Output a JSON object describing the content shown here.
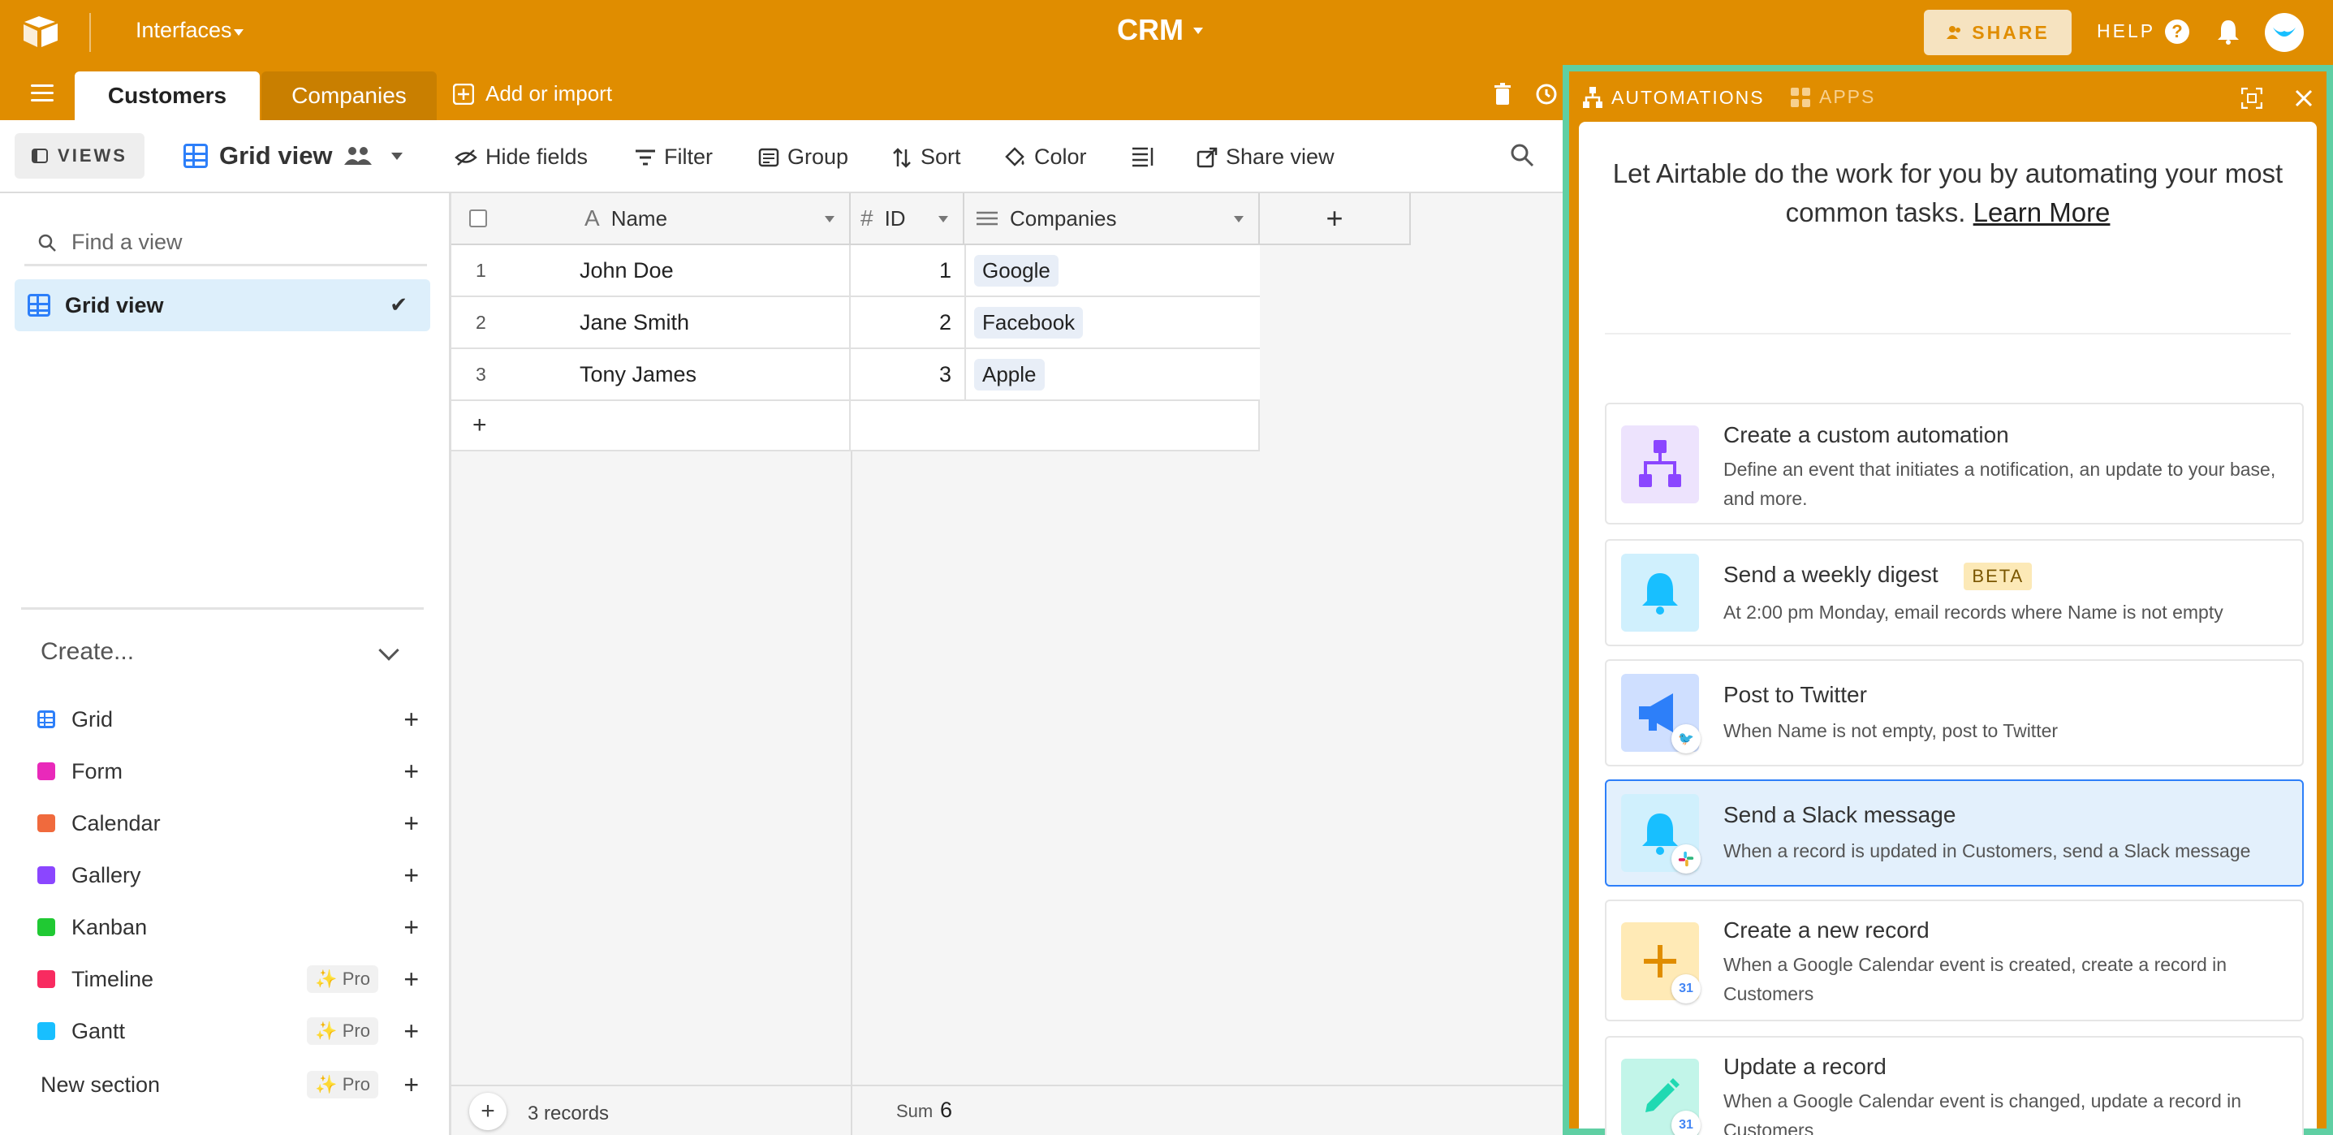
{
  "topbar": {
    "interfaces_label": "Interfaces",
    "base_name": "CRM",
    "share_label": "SHARE",
    "help_label": "HELP",
    "help_icon_glyph": "?"
  },
  "tabs": {
    "active": "Customers",
    "inactive": "Companies",
    "add_import": "Add or import"
  },
  "toolbar": {
    "views_label": "VIEWS",
    "view_name": "Grid view",
    "hide_fields": "Hide fields",
    "filter": "Filter",
    "group": "Group",
    "sort": "Sort",
    "color": "Color",
    "share_view": "Share view"
  },
  "sidebar": {
    "find_placeholder": "Find a view",
    "selected_view": "Grid view",
    "create_header": "Create...",
    "create_items": [
      {
        "label": "Grid",
        "color": "#2d7ff9"
      },
      {
        "label": "Form",
        "color": "#e929ba"
      },
      {
        "label": "Calendar",
        "color": "#f06a3d"
      },
      {
        "label": "Gallery",
        "color": "#8b46ff"
      },
      {
        "label": "Kanban",
        "color": "#20c933"
      },
      {
        "label": "Timeline",
        "color": "#f82b60",
        "pro": "Pro"
      },
      {
        "label": "Gantt",
        "color": "#18bfff",
        "pro": "Pro"
      }
    ],
    "new_section": "New section",
    "new_section_pro": "Pro"
  },
  "grid": {
    "columns": [
      {
        "name": "Name",
        "icon": "text-icon"
      },
      {
        "name": "ID",
        "icon": "number-icon"
      },
      {
        "name": "Companies",
        "icon": "link-icon"
      }
    ],
    "rows": [
      {
        "num": "1",
        "name": "John Doe",
        "id": "1",
        "company": "Google"
      },
      {
        "num": "2",
        "name": "Jane Smith",
        "id": "2",
        "company": "Facebook"
      },
      {
        "num": "3",
        "name": "Tony James",
        "id": "3",
        "company": "Apple"
      }
    ],
    "record_count": "3 records",
    "sum_label": "Sum",
    "sum_value": "6"
  },
  "panel": {
    "automations_tab": "AUTOMATIONS",
    "apps_tab": "APPS",
    "intro_text": "Let Airtable do the work for you by automating your most common tasks.",
    "learn_more": "Learn More",
    "cards": [
      {
        "title": "Create a custom automation",
        "desc": "Define an event that initiates a notification, an update to your base, and more.",
        "icon": "flow-icon"
      },
      {
        "title": "Send a weekly digest",
        "badge": "BETA",
        "desc": "At 2:00 pm Monday, email records where Name is not empty",
        "icon": "bell-icon"
      },
      {
        "title": "Post to Twitter",
        "desc": "When Name is not empty, post to Twitter",
        "icon": "megaphone-icon"
      },
      {
        "title": "Send a Slack message",
        "desc": "When a record is updated in Customers, send a Slack message",
        "icon": "bell-icon"
      },
      {
        "title": "Create a new record",
        "desc": "When a Google Calendar event is created, create a record in Customers",
        "icon": "plus-icon"
      },
      {
        "title": "Update a record",
        "desc": "When a Google Calendar event is changed, update a record in Customers",
        "icon": "pencil-icon"
      }
    ],
    "calendar_badge": "31"
  },
  "colors": {
    "brand_orange": "#e08d00",
    "panel_border": "#5fcfa3",
    "selection_blue": "#2d7ff9"
  }
}
